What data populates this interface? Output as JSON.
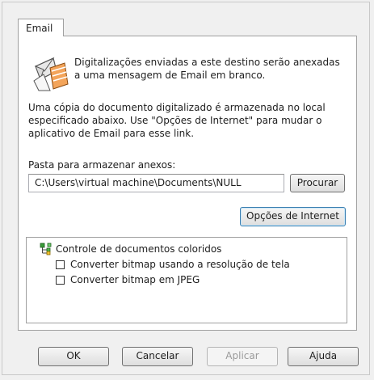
{
  "tab": {
    "label": "Email"
  },
  "intro": {
    "line1": "Digitalizações enviadas a este destino serão anexadas",
    "line2": "a uma mensagem de Email em branco."
  },
  "info": {
    "line1": "Uma cópia do documento digitalizado é armazenada no local",
    "line2": "especificado abaixo. Use \"Opções de Internet\" para mudar o",
    "line3": "aplicativo de Email para esse link."
  },
  "folder": {
    "label": "Pasta para armazenar anexos:",
    "value": "C:\\Users\\virtual machine\\Documents\\NULL",
    "browse_label": "Procurar"
  },
  "internet_options_label": "Opções de Internet",
  "color_docs": {
    "title": "Controle de documentos coloridos",
    "options": [
      {
        "label": "Converter bitmap usando a resolução de tela",
        "checked": false
      },
      {
        "label": "Converter bitmap em JPEG",
        "checked": false
      }
    ]
  },
  "footer": {
    "ok_label": "OK",
    "cancel_label": "Cancelar",
    "apply_label": "Aplicar",
    "help_label": "Ajuda"
  },
  "icons": {
    "email": "envelope-icon",
    "tree": "color-tree-icon"
  }
}
